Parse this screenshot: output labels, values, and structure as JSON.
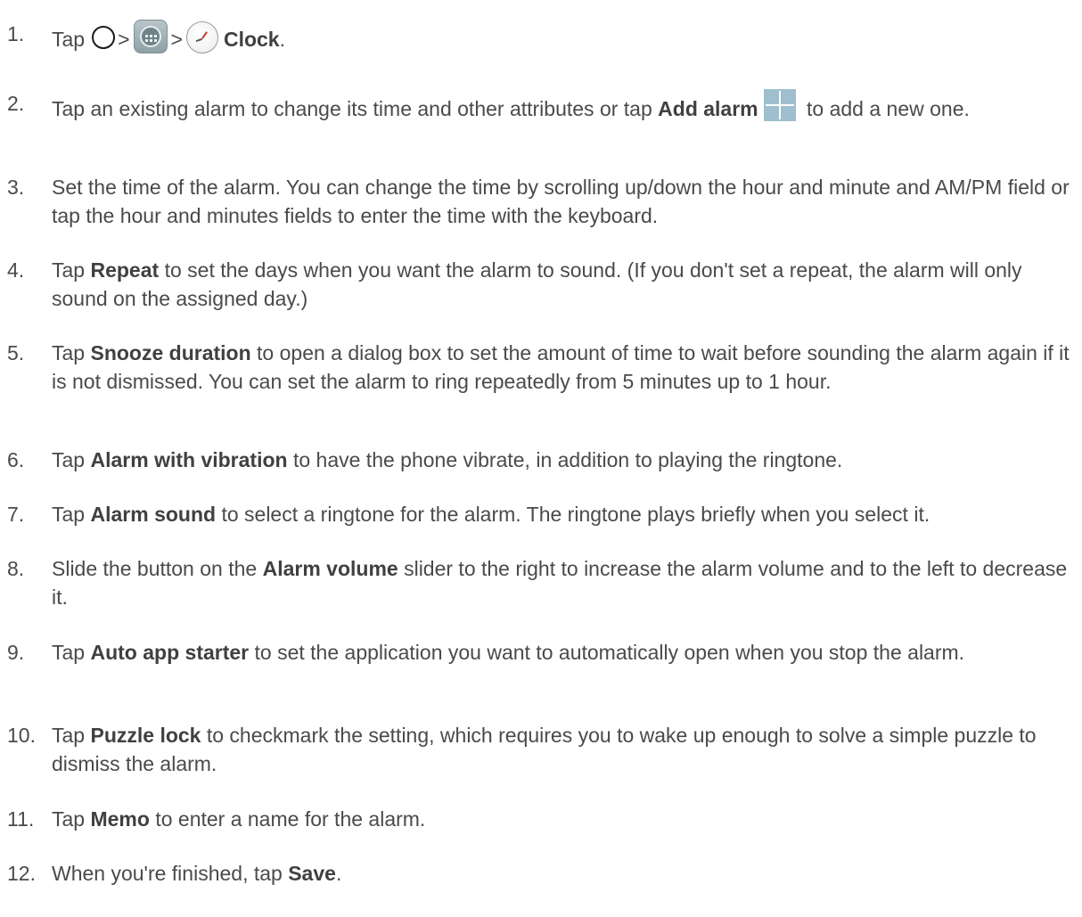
{
  "steps": [
    {
      "num": "1.",
      "tap": "Tap",
      "sep1": ">",
      "sep2": ">",
      "clock": "Clock",
      "end": ".",
      "icons": [
        "home-icon",
        "apps-icon",
        "clock-app-icon"
      ]
    },
    {
      "num": "2.",
      "pre": "Tap an existing alarm to change its time and other attributes or tap ",
      "bold": "Add alarm",
      "post": " to add a new one.",
      "icon": "add-alarm-icon"
    },
    {
      "num": "3.",
      "text": "Set the time of the alarm. You can change the time by scrolling up/down the hour and minute and AM/PM field or tap the hour and minutes fields to enter the time with the keyboard."
    },
    {
      "num": "4.",
      "pre": "Tap ",
      "bold": "Repeat",
      "post": " to set the days when you want the alarm to sound. (If you don't set a repeat, the alarm will only sound on the assigned day.)"
    },
    {
      "num": "5.",
      "pre": "Tap ",
      "bold": "Snooze duration",
      "post": " to open a dialog box to set the amount of time to wait before sounding the alarm again if it is not dismissed. You can set the alarm to ring repeatedly from 5 minutes up to 1 hour."
    },
    {
      "num": "6.",
      "pre": "Tap ",
      "bold": "Alarm with vibration",
      "post": " to have the phone vibrate, in addition to playing the ringtone."
    },
    {
      "num": "7.",
      "pre": "Tap ",
      "bold": "Alarm sound",
      "post": " to select a ringtone for the alarm. The ringtone plays briefly when you select it."
    },
    {
      "num": "8.",
      "pre": "Slide the button on the ",
      "bold": "Alarm volume",
      "post": " slider to the right to increase the alarm volume and to the left to decrease it."
    },
    {
      "num": "9.",
      "pre": "Tap ",
      "bold": "Auto app starter",
      "post": " to set the application you want to automatically open when you stop the alarm."
    },
    {
      "num": "10.",
      "pre": "Tap ",
      "bold": "Puzzle lock",
      "post": " to checkmark the setting, which requires you to wake up enough to solve a simple puzzle to dismiss the alarm."
    },
    {
      "num": "11.",
      "pre": "Tap ",
      "bold": "Memo",
      "post": " to enter a name for the alarm."
    },
    {
      "num": "12.",
      "pre": "When you're finished, tap ",
      "bold": "Save",
      "post": "."
    }
  ]
}
